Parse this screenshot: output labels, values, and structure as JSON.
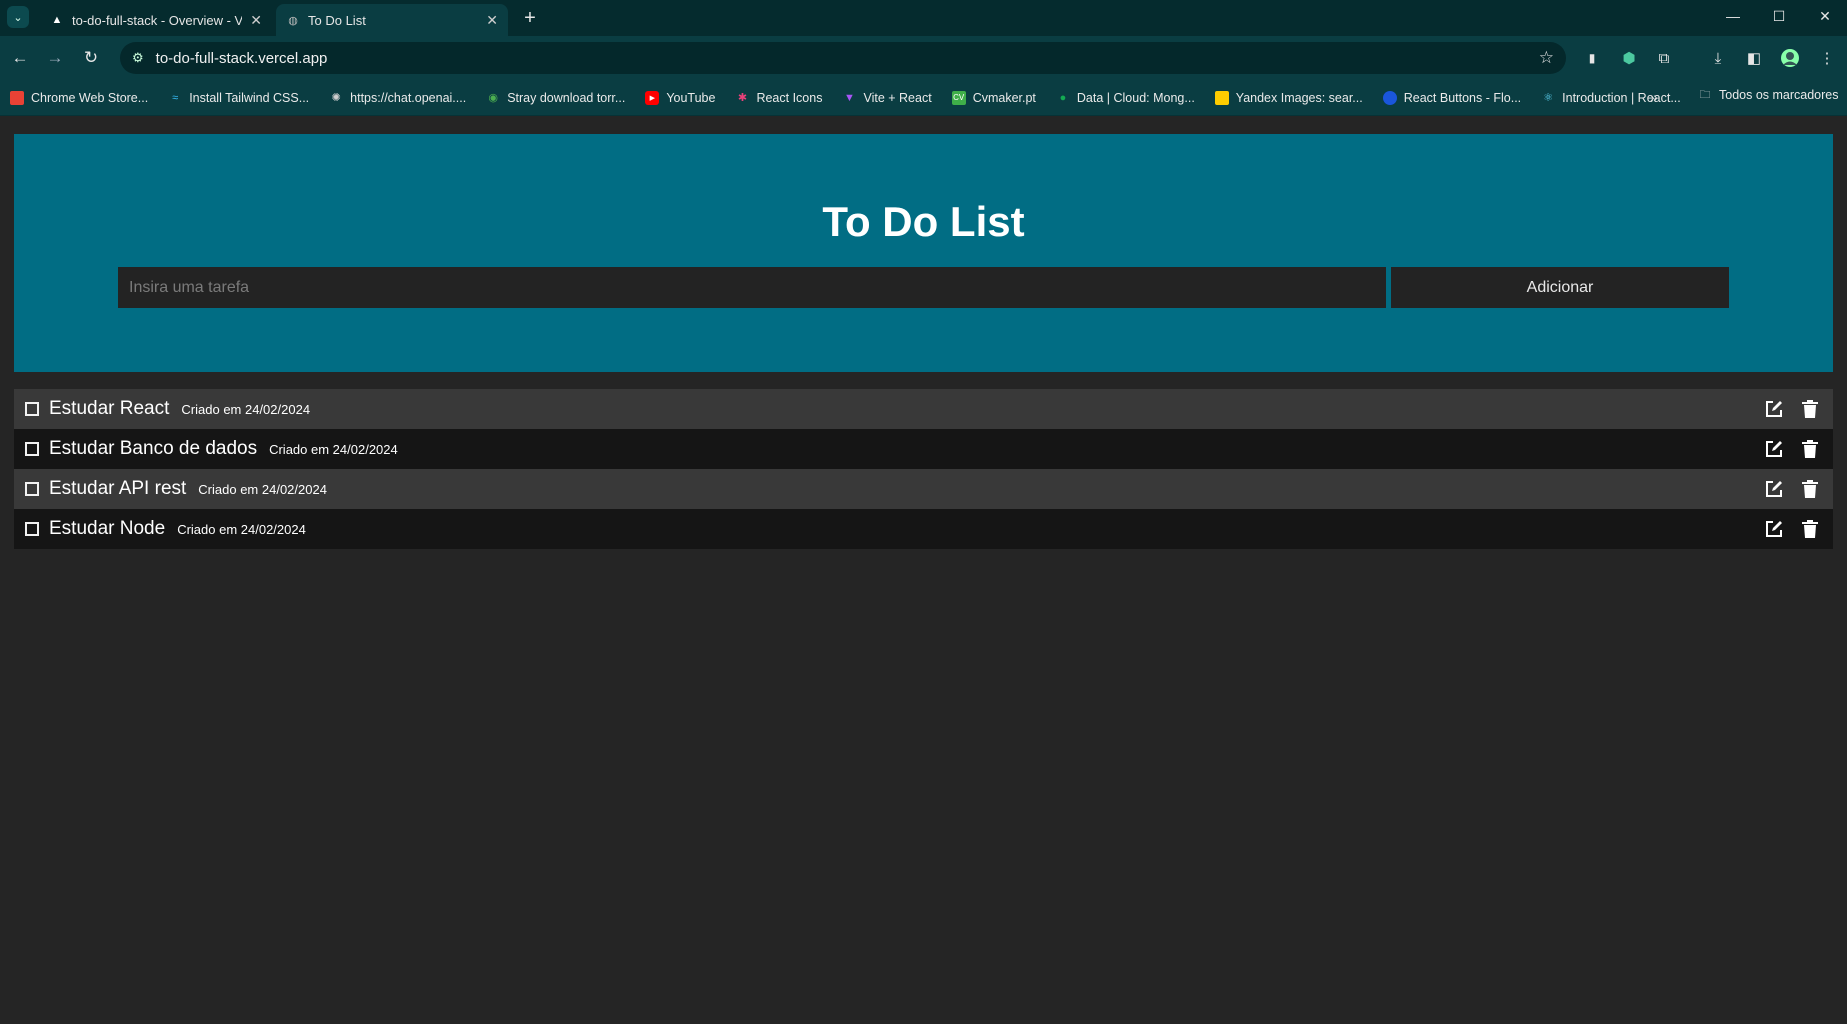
{
  "browser": {
    "tabs": [
      {
        "title": "to-do-full-stack - Overview - Ve",
        "icon": "triangle-icon"
      },
      {
        "title": "To Do List",
        "icon": "globe-icon"
      }
    ],
    "url": "to-do-full-stack.vercel.app",
    "bookmarks": [
      {
        "label": "Chrome Web Store...",
        "icon": "chrome-store-icon",
        "color": "#e94235"
      },
      {
        "label": "Install Tailwind CSS...",
        "icon": "tailwind-icon",
        "color": "#38bdf8"
      },
      {
        "label": "https://chat.openai....",
        "icon": "openai-icon",
        "color": "#d0d0d0"
      },
      {
        "label": "Stray download torr...",
        "icon": "torrent-icon",
        "color": "#4caf50"
      },
      {
        "label": "YouTube",
        "icon": "youtube-icon",
        "color": "#ff0000"
      },
      {
        "label": "React Icons",
        "icon": "react-icons-icon",
        "color": "#e9417a"
      },
      {
        "label": "Vite + React",
        "icon": "vite-icon",
        "color": "#a855f7"
      },
      {
        "label": "Cvmaker.pt",
        "icon": "cvmaker-icon",
        "color": "#3fae49"
      },
      {
        "label": "Data | Cloud: Mong...",
        "icon": "mongodb-icon",
        "color": "#13aa52"
      },
      {
        "label": "Yandex Images: sear...",
        "icon": "yandex-icon",
        "color": "#ffcc00"
      },
      {
        "label": "React Buttons - Flo...",
        "icon": "flowbite-icon",
        "color": "#1a56db"
      },
      {
        "label": "Introduction | React...",
        "icon": "react-icon",
        "color": "#61dafb"
      }
    ],
    "bookmarks_folder": "Todos os marcadores"
  },
  "app": {
    "title": "To Do List",
    "input_placeholder": "Insira uma tarefa",
    "add_label": "Adicionar",
    "accent_color": "#016d84",
    "tasks": [
      {
        "name": "Estudar React",
        "created": "Criado em 24/02/2024",
        "done": false
      },
      {
        "name": "Estudar Banco de dados",
        "created": "Criado em 24/02/2024",
        "done": false
      },
      {
        "name": "Estudar API rest",
        "created": "Criado em 24/02/2024",
        "done": false
      },
      {
        "name": "Estudar Node",
        "created": "Criado em 24/02/2024",
        "done": false
      }
    ]
  }
}
